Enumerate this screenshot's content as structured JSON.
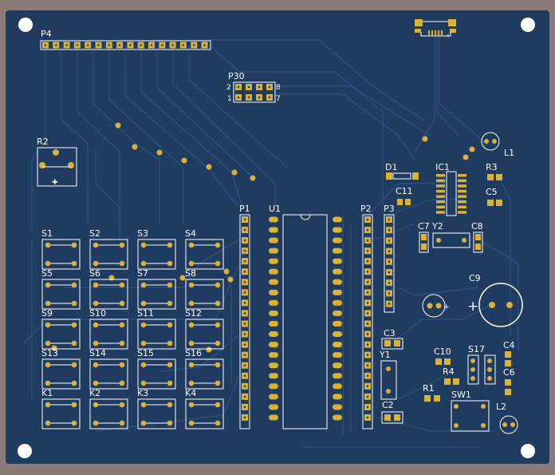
{
  "board": {
    "colors": {
      "background": "#8a7a78",
      "pcb": "#1f3b60",
      "trace": "#2c4f7d",
      "pad": "#d9b23a",
      "silk": "#ffffff",
      "hole": "#ffffff"
    }
  },
  "labels": {
    "p4": "P4",
    "p30": "P30",
    "p30_pin2": "2",
    "p30_pin8": "8",
    "p30_pin1": "1",
    "p30_pin7": "7",
    "r2": "R2",
    "d1": "D1",
    "ic1": "IC1",
    "r3": "R3",
    "l1": "L1",
    "c11": "C11",
    "c5": "C5",
    "p1": "P1",
    "u1": "U1",
    "p2": "P2",
    "p3": "P3",
    "c7": "C7",
    "y2": "Y2",
    "c8": "C8",
    "c9": "C9",
    "c3": "C3",
    "y1": "Y1",
    "c2": "C2",
    "c10": "C10",
    "s17": "S17",
    "c4": "C4",
    "r4": "R4",
    "c6": "C6",
    "r1": "R1",
    "sw1": "SW1",
    "l2": "L2",
    "plus": "+"
  },
  "switches": [
    [
      "S1",
      "S2",
      "S3",
      "S4"
    ],
    [
      "S5",
      "S6",
      "S7",
      "S8"
    ],
    [
      "S9",
      "S10",
      "S11",
      "S12"
    ],
    [
      "S13",
      "S14",
      "S15",
      "S16"
    ],
    [
      "K1",
      "K2",
      "K3",
      "K4"
    ]
  ]
}
